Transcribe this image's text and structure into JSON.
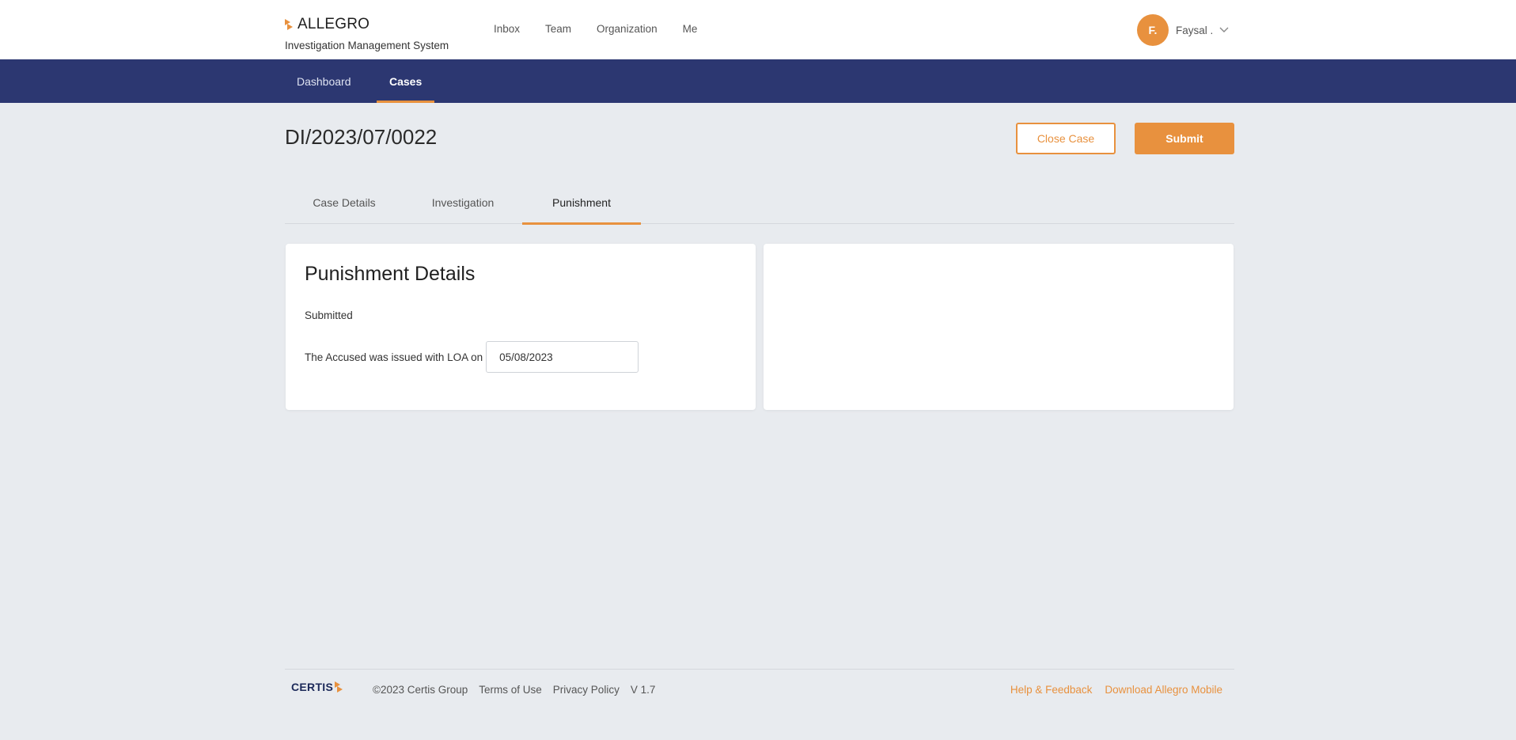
{
  "header": {
    "brand_name": "ALLEGRO",
    "brand_subtitle": "Investigation Management System",
    "nav": [
      "Inbox",
      "Team",
      "Organization",
      "Me"
    ],
    "user": {
      "initial": "F.",
      "name": "Faysal ."
    }
  },
  "navbar": {
    "tabs": [
      "Dashboard",
      "Cases"
    ],
    "active": "Cases"
  },
  "case": {
    "id": "DI/2023/07/0022",
    "close_label": "Close Case",
    "submit_label": "Submit"
  },
  "tabs": {
    "items": [
      "Case Details",
      "Investigation",
      "Punishment"
    ],
    "active": "Punishment"
  },
  "punishment": {
    "title": "Punishment Details",
    "status": "Submitted",
    "loa_label": "The Accused was issued with LOA on",
    "loa_date": "05/08/2023"
  },
  "footer": {
    "logo_text": "CERTIS",
    "copyright": "©2023 Certis Group",
    "terms": "Terms of Use",
    "privacy": "Privacy Policy",
    "version": "V 1.7",
    "help": "Help & Feedback",
    "download": "Download Allegro Mobile"
  },
  "colors": {
    "accent": "#e8913e",
    "navbar": "#2c3771",
    "background": "#e8ebef"
  }
}
